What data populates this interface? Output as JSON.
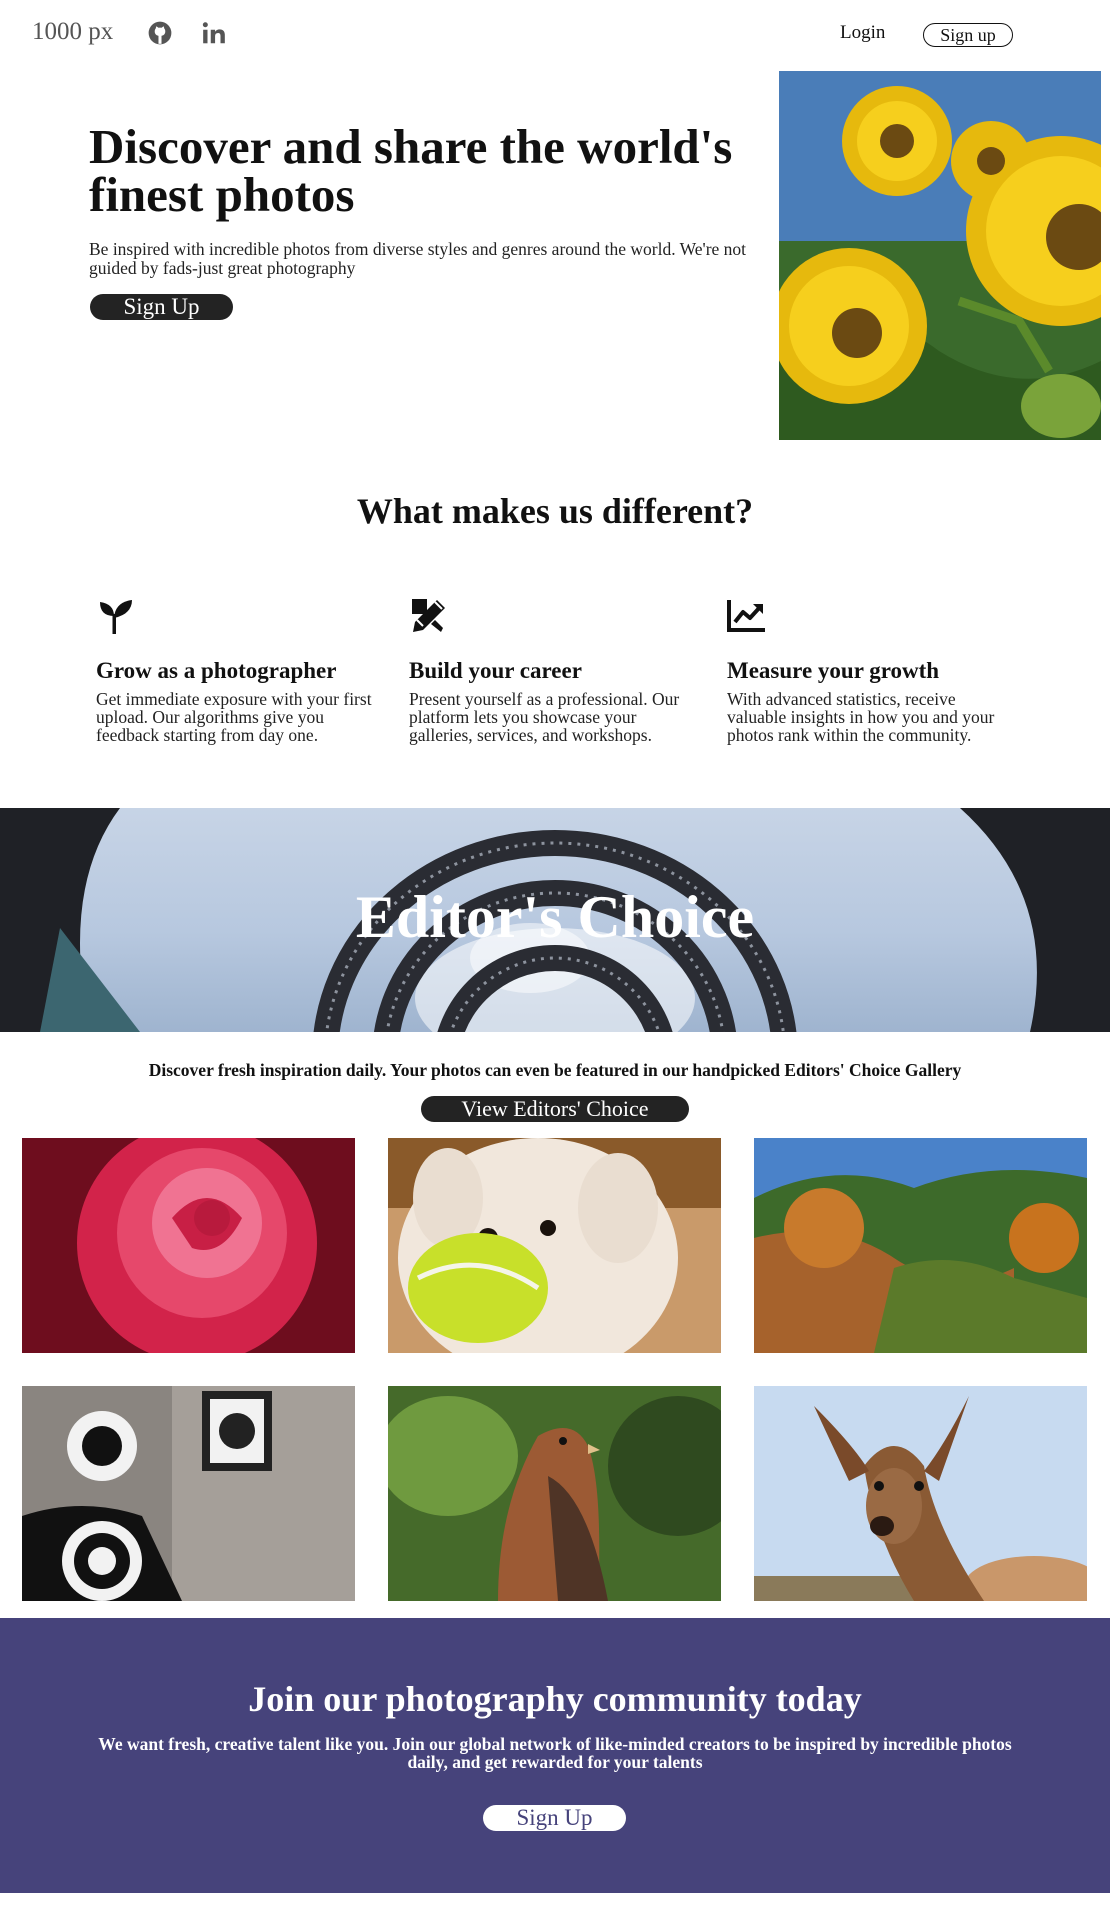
{
  "nav": {
    "logo": "1000 px",
    "login": "Login",
    "signup": "Sign up",
    "icons": [
      "github-icon",
      "linkedin-icon"
    ]
  },
  "hero": {
    "title": "Discover and share the world's finest photos",
    "subtitle": "Be inspired with incredible photos from diverse styles and genres around the world. We're not guided by fads-just great photography",
    "cta": "Sign Up"
  },
  "features": {
    "title": "What makes us different?",
    "items": [
      {
        "icon": "seedling-icon",
        "title": "Grow as a photographer",
        "text": "Get immediate exposure with your first upload. Our algorithms give you feedback starting from day one."
      },
      {
        "icon": "pencil-ruler-icon",
        "title": "Build your career",
        "text": "Present yourself as a professional. Our platform lets you showcase your galleries, services, and workshops."
      },
      {
        "icon": "chart-line-icon",
        "title": "Measure your growth",
        "text": "With advanced statistics, receive valuable insights in how you and your photos rank within the community."
      }
    ]
  },
  "editors": {
    "title": "Editor's Choice",
    "caption": "Discover fresh inspiration daily. Your photos can even be featured in our handpicked Editors' Choice Gallery",
    "cta": "View Editors' Choice"
  },
  "join": {
    "title": "Join our photography community today",
    "subtitle": "We want fresh, creative talent like you. Join our global network of like-minded creators to be inspired by incredible photos daily, and get rewarded for your talents",
    "cta": "Sign Up"
  },
  "colors": {
    "dark_button": "#232323",
    "join_background": "#46437b",
    "text": "#111111"
  }
}
